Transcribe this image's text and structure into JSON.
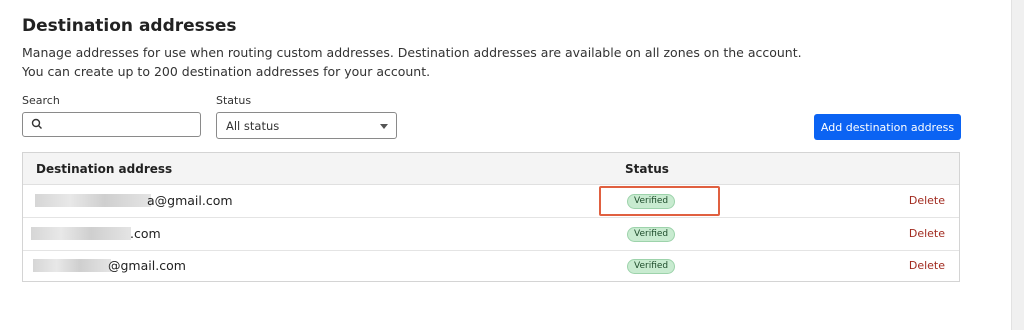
{
  "section": {
    "title": "Destination addresses",
    "description_line1": "Manage addresses for use when routing custom addresses. Destination addresses are available on all zones on the account.",
    "description_line2": "You can create up to 200 destination addresses for your account."
  },
  "filters": {
    "search_label": "Search",
    "search_value": "",
    "status_label": "Status",
    "status_selected": "All status"
  },
  "actions": {
    "add_label": "Add destination address"
  },
  "table": {
    "columns": [
      "Destination address",
      "Status"
    ],
    "rows": [
      {
        "address_visible": "a@gmail.com",
        "status": "Verified",
        "action": "Delete"
      },
      {
        "address_visible": ".com",
        "status": "Verified",
        "action": "Delete"
      },
      {
        "address_visible": "@gmail.com",
        "status": "Verified",
        "action": "Delete"
      }
    ]
  },
  "colors": {
    "primary_button": "#0b63f3",
    "verified_badge": "#c8ebd0",
    "delete_link": "#a12a1f",
    "highlight": "#e06040"
  }
}
